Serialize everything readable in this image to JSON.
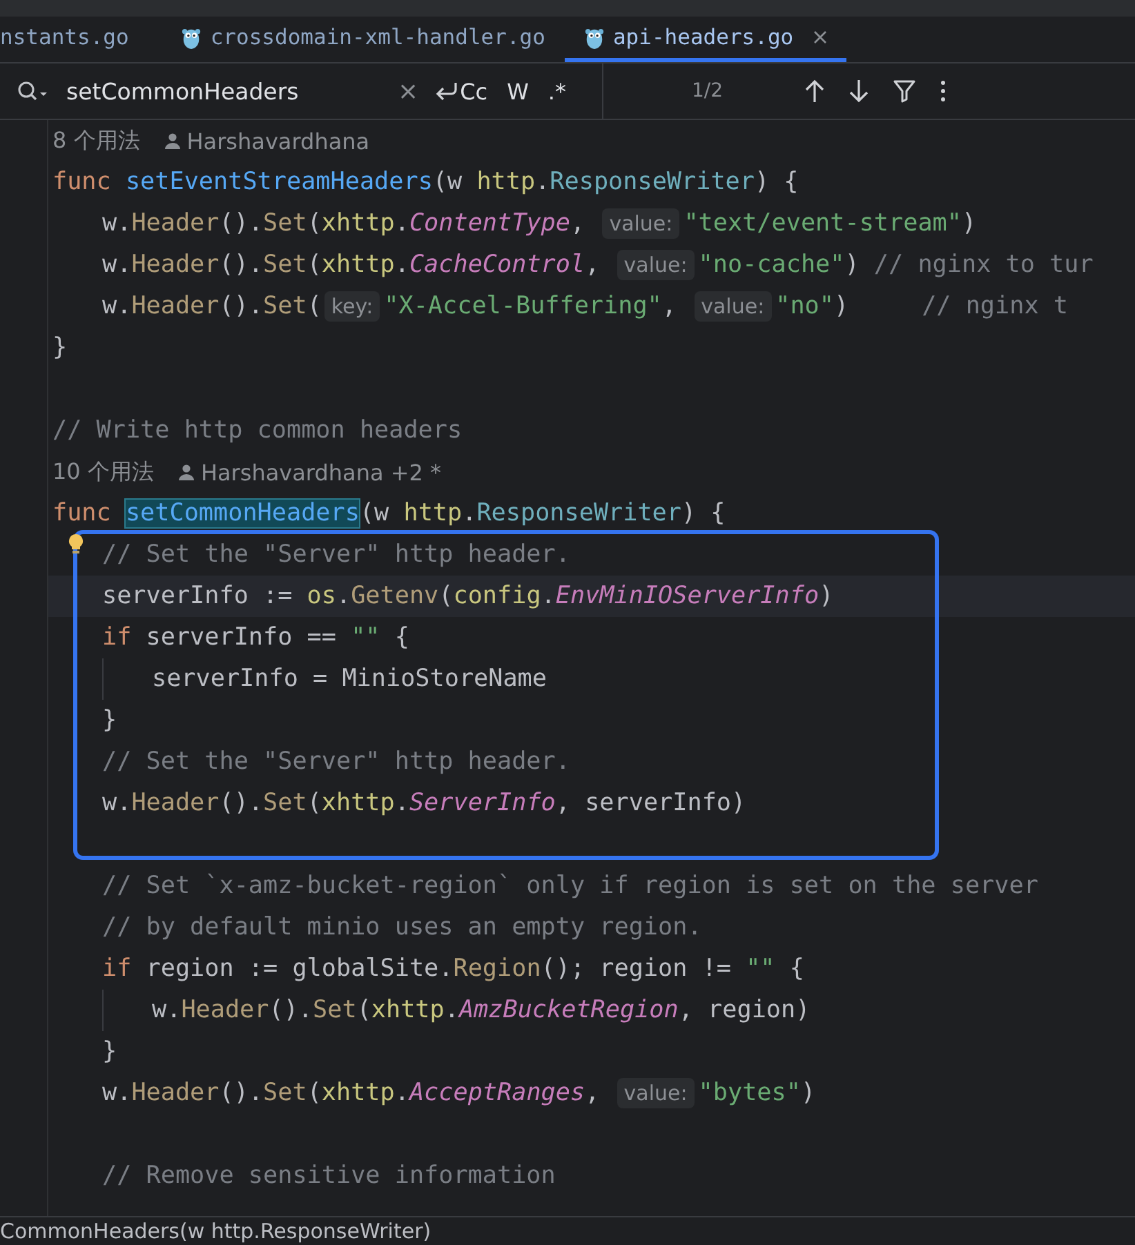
{
  "tabs": [
    {
      "label": "nstants.go",
      "selected": false
    },
    {
      "label": "crossdomain-xml-handler.go",
      "selected": false
    },
    {
      "label": "api-headers.go",
      "selected": true
    }
  ],
  "find_bar": {
    "query": "setCommonHeaders",
    "clear": "×",
    "case_toggle": "Cc",
    "word_toggle": "W",
    "regex_toggle": ".*",
    "match_count": "1/2"
  },
  "editor": {
    "rows": [
      {
        "kind": "meta",
        "current": false,
        "usages": "8 个用法",
        "author": "Harshavardhana"
      },
      {
        "kind": "code",
        "current": false,
        "spans": [
          {
            "kind": "kw",
            "text": "func "
          },
          {
            "kind": "decl",
            "text": "setEventStreamHeaders"
          },
          {
            "kind": "plain",
            "text": "(w "
          },
          {
            "kind": "pkg",
            "text": "http"
          },
          {
            "kind": "plain",
            "text": "."
          },
          {
            "kind": "type",
            "text": "ResponseWriter"
          },
          {
            "kind": "plain",
            "text": ") {"
          }
        ],
        "children": [
          {
            "kind": "code",
            "current": false,
            "spans": [
              {
                "kind": "plain",
                "text": "w."
              },
              {
                "kind": "method",
                "text": "Header"
              },
              {
                "kind": "plain",
                "text": "()."
              },
              {
                "kind": "method",
                "text": "Set"
              },
              {
                "kind": "plain",
                "text": "("
              },
              {
                "kind": "pkg",
                "text": "xhttp"
              },
              {
                "kind": "plain",
                "text": "."
              },
              {
                "kind": "const",
                "text": "ContentType"
              },
              {
                "kind": "plain",
                "text": ", "
              },
              {
                "kind": "hint",
                "text": "value:"
              },
              {
                "kind": "str",
                "text": "\"text/event-stream\""
              },
              {
                "kind": "plain",
                "text": ")"
              }
            ]
          },
          {
            "kind": "code",
            "current": false,
            "spans": [
              {
                "kind": "plain",
                "text": "w."
              },
              {
                "kind": "method",
                "text": "Header"
              },
              {
                "kind": "plain",
                "text": "()."
              },
              {
                "kind": "method",
                "text": "Set"
              },
              {
                "kind": "plain",
                "text": "("
              },
              {
                "kind": "pkg",
                "text": "xhttp"
              },
              {
                "kind": "plain",
                "text": "."
              },
              {
                "kind": "const",
                "text": "CacheControl"
              },
              {
                "kind": "plain",
                "text": ", "
              },
              {
                "kind": "hint",
                "text": "value:"
              },
              {
                "kind": "str",
                "text": "\"no-cache\""
              },
              {
                "kind": "plain",
                "text": ") "
              },
              {
                "kind": "comment",
                "text": "// nginx to tur"
              }
            ]
          },
          {
            "kind": "code",
            "current": false,
            "spans": [
              {
                "kind": "plain",
                "text": "w."
              },
              {
                "kind": "method",
                "text": "Header"
              },
              {
                "kind": "plain",
                "text": "()."
              },
              {
                "kind": "method",
                "text": "Set"
              },
              {
                "kind": "plain",
                "text": "("
              },
              {
                "kind": "hint",
                "text": "key:"
              },
              {
                "kind": "str",
                "text": "\"X-Accel-Buffering\""
              },
              {
                "kind": "plain",
                "text": ", "
              },
              {
                "kind": "hint",
                "text": "value:"
              },
              {
                "kind": "str",
                "text": "\"no\""
              },
              {
                "kind": "plain",
                "text": ")     "
              },
              {
                "kind": "comment",
                "text": "// nginx t"
              }
            ]
          }
        ]
      },
      {
        "kind": "code",
        "current": false,
        "spans": [
          {
            "kind": "plain",
            "text": "}"
          }
        ]
      },
      {
        "kind": "blank",
        "current": false
      },
      {
        "kind": "code",
        "current": false,
        "spans": [
          {
            "kind": "comment",
            "text": "// Write http common headers"
          }
        ]
      },
      {
        "kind": "meta",
        "current": false,
        "usages": "10 个用法",
        "author": "Harshavardhana +2 *"
      },
      {
        "kind": "code",
        "current": false,
        "spans": [
          {
            "kind": "kw",
            "text": "func "
          },
          {
            "kind": "match",
            "text": "setCommonHeaders"
          },
          {
            "kind": "plain",
            "text": "(w "
          },
          {
            "kind": "pkg",
            "text": "http"
          },
          {
            "kind": "plain",
            "text": "."
          },
          {
            "kind": "type",
            "text": "ResponseWriter"
          },
          {
            "kind": "plain",
            "text": ") {"
          }
        ],
        "children": [
          {
            "kind": "code",
            "current": false,
            "spans": [
              {
                "kind": "comment",
                "text": "// Set the \"Server\" http header."
              }
            ]
          },
          {
            "kind": "code",
            "current": true,
            "spans": [
              {
                "kind": "plain",
                "text": "serverInfo := "
              },
              {
                "kind": "pkg",
                "text": "os"
              },
              {
                "kind": "plain",
                "text": "."
              },
              {
                "kind": "method",
                "text": "Getenv"
              },
              {
                "kind": "plain",
                "text": "("
              },
              {
                "kind": "pkg",
                "text": "config"
              },
              {
                "kind": "plain",
                "text": "."
              },
              {
                "kind": "const",
                "text": "EnvMinIOServerInfo"
              },
              {
                "kind": "plain",
                "text": ")"
              }
            ]
          },
          {
            "kind": "code",
            "current": false,
            "spans": [
              {
                "kind": "kw",
                "text": "if "
              },
              {
                "kind": "plain",
                "text": "serverInfo == "
              },
              {
                "kind": "str",
                "text": "\"\""
              },
              {
                "kind": "plain",
                "text": " {"
              }
            ],
            "children": [
              {
                "kind": "code",
                "current": false,
                "spans": [
                  {
                    "kind": "plain",
                    "text": "serverInfo = MinioStoreName"
                  }
                ]
              }
            ]
          },
          {
            "kind": "code",
            "current": false,
            "spans": [
              {
                "kind": "plain",
                "text": "}"
              }
            ]
          },
          {
            "kind": "code",
            "current": false,
            "spans": [
              {
                "kind": "comment",
                "text": "// Set the \"Server\" http header."
              }
            ]
          },
          {
            "kind": "code",
            "current": false,
            "spans": [
              {
                "kind": "plain",
                "text": "w."
              },
              {
                "kind": "method",
                "text": "Header"
              },
              {
                "kind": "plain",
                "text": "()."
              },
              {
                "kind": "method",
                "text": "Set"
              },
              {
                "kind": "plain",
                "text": "("
              },
              {
                "kind": "pkg",
                "text": "xhttp"
              },
              {
                "kind": "plain",
                "text": "."
              },
              {
                "kind": "const",
                "text": "ServerInfo"
              },
              {
                "kind": "plain",
                "text": ", serverInfo)"
              }
            ]
          },
          {
            "kind": "blank",
            "current": false
          },
          {
            "kind": "code",
            "current": false,
            "spans": [
              {
                "kind": "comment",
                "text": "// Set `x-amz-bucket-region` only if region is set on the server"
              }
            ]
          },
          {
            "kind": "code",
            "current": false,
            "spans": [
              {
                "kind": "comment",
                "text": "// by default minio uses an empty region."
              }
            ]
          },
          {
            "kind": "code",
            "current": false,
            "spans": [
              {
                "kind": "kw",
                "text": "if "
              },
              {
                "kind": "plain",
                "text": "region := globalSite."
              },
              {
                "kind": "method",
                "text": "Region"
              },
              {
                "kind": "plain",
                "text": "(); region != "
              },
              {
                "kind": "str",
                "text": "\"\""
              },
              {
                "kind": "plain",
                "text": " {"
              }
            ],
            "children": [
              {
                "kind": "code",
                "current": false,
                "spans": [
                  {
                    "kind": "plain",
                    "text": "w."
                  },
                  {
                    "kind": "method",
                    "text": "Header"
                  },
                  {
                    "kind": "plain",
                    "text": "()."
                  },
                  {
                    "kind": "method",
                    "text": "Set"
                  },
                  {
                    "kind": "plain",
                    "text": "("
                  },
                  {
                    "kind": "pkg",
                    "text": "xhttp"
                  },
                  {
                    "kind": "plain",
                    "text": "."
                  },
                  {
                    "kind": "const",
                    "text": "AmzBucketRegion"
                  },
                  {
                    "kind": "plain",
                    "text": ", region)"
                  }
                ]
              }
            ]
          },
          {
            "kind": "code",
            "current": false,
            "spans": [
              {
                "kind": "plain",
                "text": "}"
              }
            ]
          },
          {
            "kind": "code",
            "current": false,
            "spans": [
              {
                "kind": "plain",
                "text": "w."
              },
              {
                "kind": "method",
                "text": "Header"
              },
              {
                "kind": "plain",
                "text": "()."
              },
              {
                "kind": "method",
                "text": "Set"
              },
              {
                "kind": "plain",
                "text": "("
              },
              {
                "kind": "pkg",
                "text": "xhttp"
              },
              {
                "kind": "plain",
                "text": "."
              },
              {
                "kind": "const",
                "text": "AcceptRanges"
              },
              {
                "kind": "plain",
                "text": ", "
              },
              {
                "kind": "hint",
                "text": "value:"
              },
              {
                "kind": "str",
                "text": "\"bytes\""
              },
              {
                "kind": "plain",
                "text": ")"
              }
            ]
          },
          {
            "kind": "blank",
            "current": false
          },
          {
            "kind": "code",
            "current": false,
            "spans": [
              {
                "kind": "comment",
                "text": "// Remove sensitive information"
              }
            ]
          }
        ]
      }
    ]
  },
  "breadcrumb": "CommonHeaders(w http.ResponseWriter)"
}
